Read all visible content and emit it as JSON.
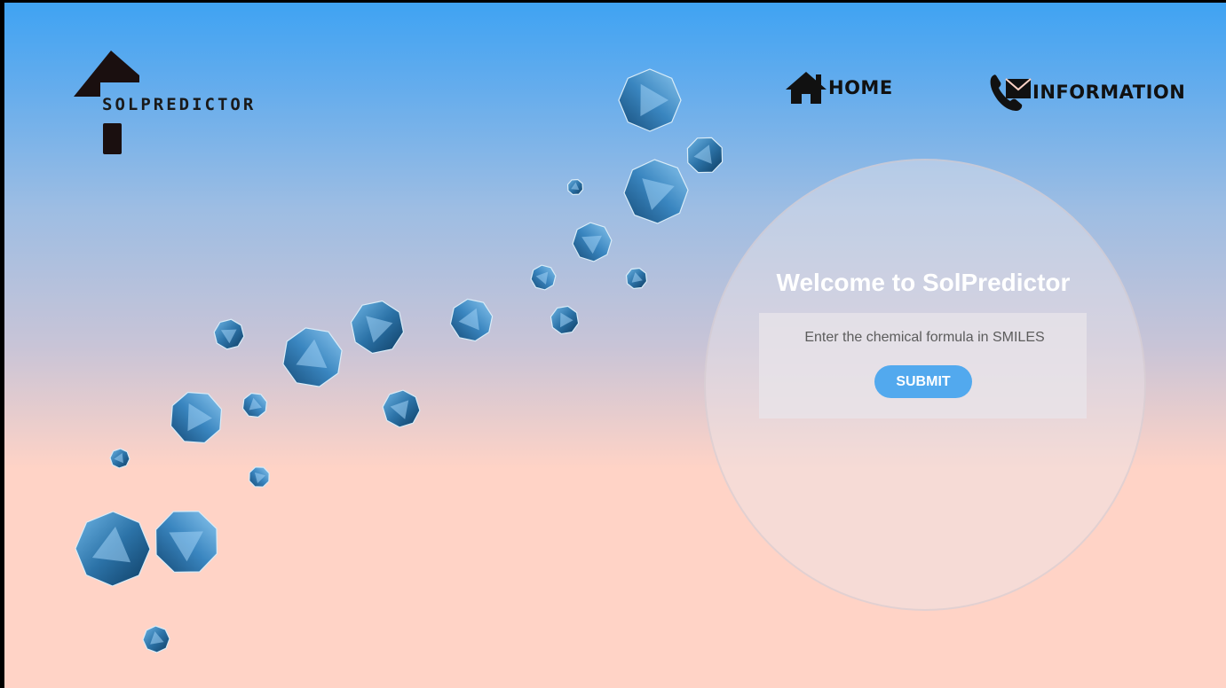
{
  "header": {
    "brand": "SOLPREDICTOR",
    "nav": {
      "home_label": "HOME",
      "home_icon": "house-icon",
      "info_label": "INFORMATION",
      "info_icon": "phone-envelope-icon"
    }
  },
  "main": {
    "welcome_title": "Welcome to SolPredictor",
    "input_placeholder": "Enter the chemical formula in SMILES",
    "input_value": "",
    "submit_label": "SUBMIT"
  },
  "colors": {
    "gradient_top": "#3fa3f3",
    "gradient_bottom": "#ffd3c6",
    "button": "#52a9ee",
    "gem": "#2f6fa3"
  }
}
